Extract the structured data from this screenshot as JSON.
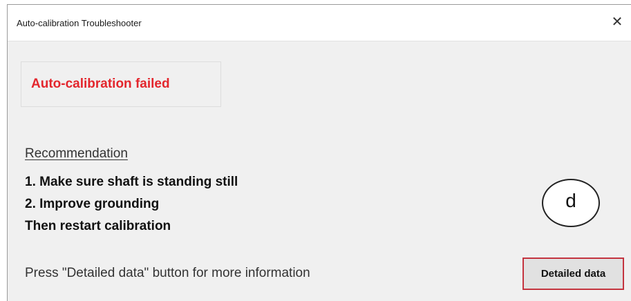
{
  "window": {
    "title": "Auto-calibration Troubleshooter",
    "close_glyph": "✕",
    "close_icon": "close-icon"
  },
  "status": {
    "message": "Auto-calibration failed",
    "color": "#e3262d"
  },
  "recommendation": {
    "heading": "Recommendation",
    "lines": [
      "1. Make sure shaft is standing still",
      "2. Improve grounding",
      "Then restart calibration"
    ]
  },
  "annotation": {
    "label": "d"
  },
  "footer": {
    "info": "Press \"Detailed data\" button for more information",
    "button_label": "Detailed data",
    "button_border_color": "#c4343f"
  }
}
